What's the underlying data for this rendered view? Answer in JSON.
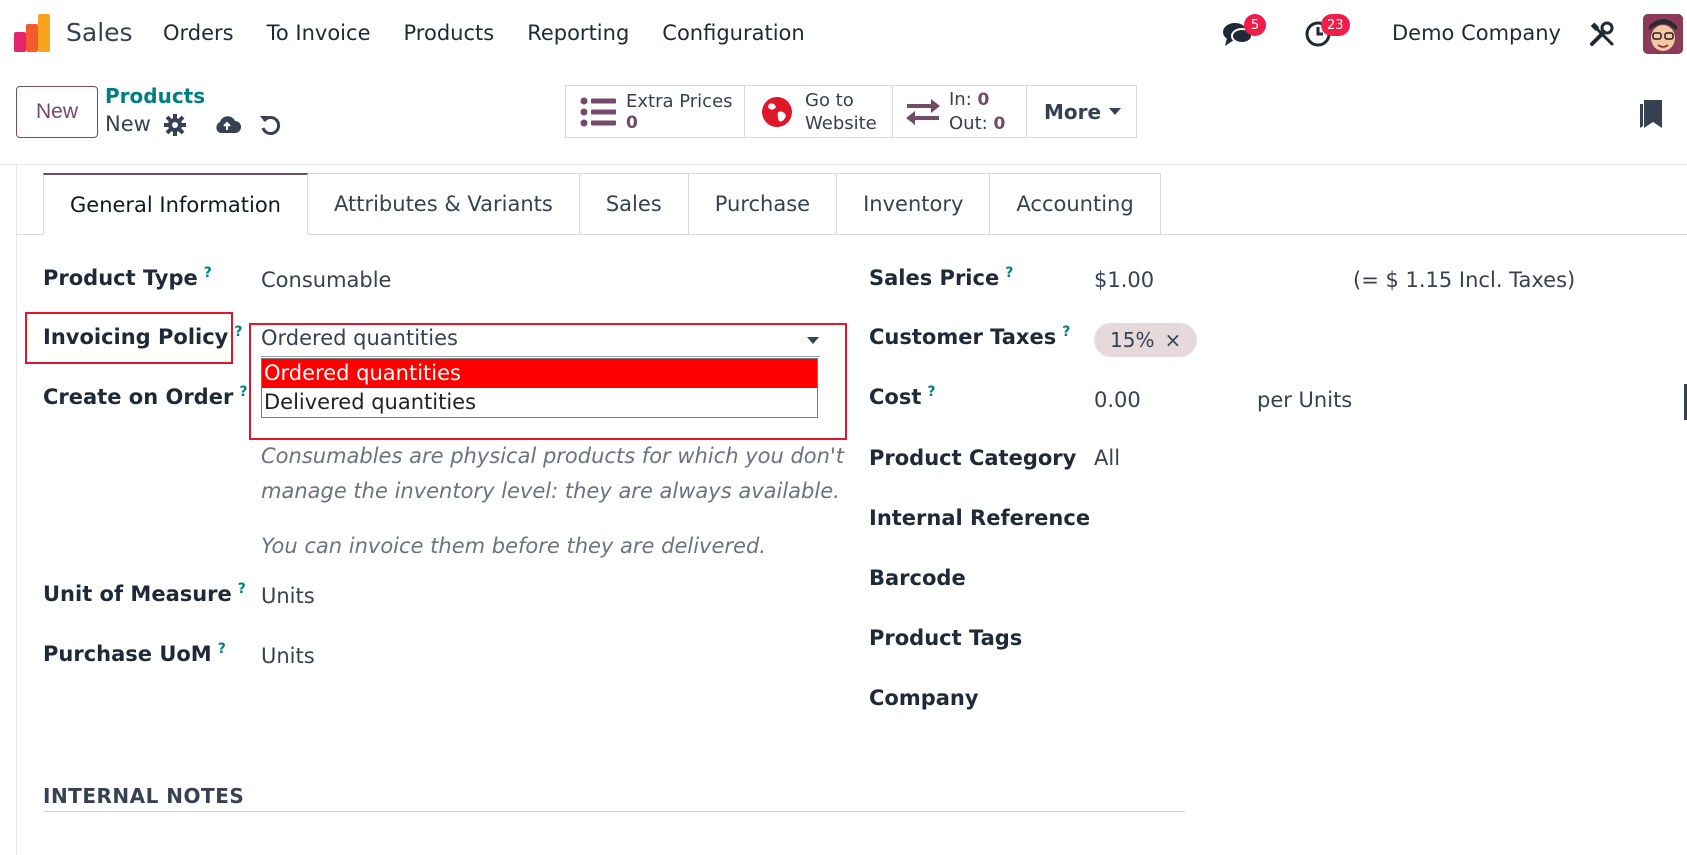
{
  "navbar": {
    "app_name": "Sales",
    "menu": [
      "Orders",
      "To Invoice",
      "Products",
      "Reporting",
      "Configuration"
    ],
    "messages_count": "5",
    "activities_count": "23",
    "company": "Demo Company"
  },
  "control_panel": {
    "new_label": "New",
    "breadcrumb_parent": "Products",
    "breadcrumb_current": "New",
    "smart_buttons": {
      "extra_prices": {
        "label": "Extra Prices",
        "value": "0"
      },
      "website": {
        "line1": "Go to",
        "line2": "Website"
      },
      "moves": {
        "in_label": "In:",
        "in_value": "0",
        "out_label": "Out:",
        "out_value": "0"
      },
      "more_label": "More"
    }
  },
  "tabs": [
    "General Information",
    "Attributes & Variants",
    "Sales",
    "Purchase",
    "Inventory",
    "Accounting"
  ],
  "form": {
    "product_type": {
      "label": "Product Type",
      "value": "Consumable"
    },
    "invoicing_policy": {
      "label": "Invoicing Policy",
      "value": "Ordered quantities",
      "options": [
        "Ordered quantities",
        "Delivered quantities"
      ]
    },
    "create_on_order": {
      "label": "Create on Order"
    },
    "help_line1": "Consumables are physical products for which you don't",
    "help_line2": "manage the inventory level: they are always available.",
    "help_line3": "You can invoice them before they are delivered.",
    "unit_of_measure": {
      "label": "Unit of Measure",
      "value": "Units"
    },
    "purchase_uom": {
      "label": "Purchase UoM",
      "value": "Units"
    },
    "sales_price": {
      "label": "Sales Price",
      "value": "$1.00",
      "incl": "(= $ 1.15 Incl. Taxes)"
    },
    "customer_taxes": {
      "label": "Customer Taxes",
      "tag": "15%",
      "remove": "×"
    },
    "cost": {
      "label": "Cost",
      "value": "0.00",
      "unit": "per Units"
    },
    "product_category": {
      "label": "Product Category",
      "value": "All"
    },
    "internal_reference": {
      "label": "Internal Reference"
    },
    "barcode": {
      "label": "Barcode"
    },
    "product_tags": {
      "label": "Product Tags"
    },
    "company": {
      "label": "Company"
    },
    "internal_notes_title": "INTERNAL NOTES",
    "help_mark": "?"
  },
  "colors": {
    "brand": "#714b67",
    "link": "#017e84",
    "highlight": "#e0162b",
    "selected_option": "#ff0000",
    "badge": "#ef1d47"
  }
}
